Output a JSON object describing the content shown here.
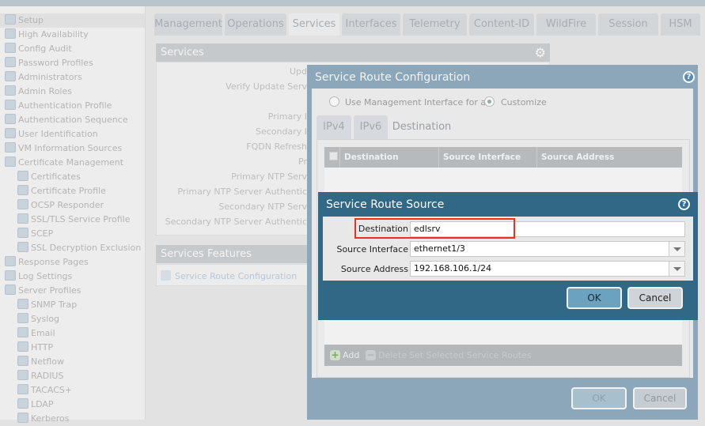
{
  "sidebar": {
    "items": [
      {
        "label": "Setup",
        "level": 0
      },
      {
        "label": "High Availability",
        "level": 0
      },
      {
        "label": "Config Audit",
        "level": 0
      },
      {
        "label": "Password Profiles",
        "level": 0
      },
      {
        "label": "Administrators",
        "level": 0
      },
      {
        "label": "Admin Roles",
        "level": 0
      },
      {
        "label": "Authentication Profile",
        "level": 0
      },
      {
        "label": "Authentication Sequence",
        "level": 0
      },
      {
        "label": "User Identification",
        "level": 0
      },
      {
        "label": "VM Information Sources",
        "level": 0
      },
      {
        "label": "Certificate Management",
        "level": 0
      },
      {
        "label": "Certificates",
        "level": 1
      },
      {
        "label": "Certificate Profile",
        "level": 1
      },
      {
        "label": "OCSP Responder",
        "level": 1
      },
      {
        "label": "SSL/TLS Service Profile",
        "level": 1
      },
      {
        "label": "SCEP",
        "level": 1
      },
      {
        "label": "SSL Decryption Exclusion",
        "level": 1
      },
      {
        "label": "Response Pages",
        "level": 0
      },
      {
        "label": "Log Settings",
        "level": 0
      },
      {
        "label": "Server Profiles",
        "level": 0
      },
      {
        "label": "SNMP Trap",
        "level": 1
      },
      {
        "label": "Syslog",
        "level": 1
      },
      {
        "label": "Email",
        "level": 1
      },
      {
        "label": "HTTP",
        "level": 1
      },
      {
        "label": "Netflow",
        "level": 1
      },
      {
        "label": "RADIUS",
        "level": 1
      },
      {
        "label": "TACACS+",
        "level": 1
      },
      {
        "label": "LDAP",
        "level": 1
      },
      {
        "label": "Kerberos",
        "level": 1
      }
    ]
  },
  "tabs": [
    "Management",
    "Operations",
    "Services",
    "Interfaces",
    "Telemetry",
    "Content-ID",
    "WildFire",
    "Session",
    "HSM"
  ],
  "services": {
    "title": "Services",
    "fields": [
      "Upd",
      "Verify Update Serv",
      "Primary I",
      "Secondary I",
      "FQDN Refresh",
      "Pr",
      "Primary NTP Serv",
      "Primary NTP Server Authentic",
      "Secondary NTP Serv",
      "Secondary NTP Server Authentic"
    ]
  },
  "features": {
    "title": "Services Features",
    "link": "Service Route Configuration"
  },
  "route_config": {
    "title": "Service Route Configuration",
    "radio_mgmt": "Use Management Interface for all",
    "radio_custom": "Customize",
    "tabs": [
      "IPv4",
      "IPv6",
      "Destination"
    ],
    "columns": [
      "Destination",
      "Source Interface",
      "Source Address"
    ],
    "add": "Add",
    "delete": "Delete",
    "set_selected": "Set Selected Service Routes",
    "ok": "OK",
    "cancel": "Cancel"
  },
  "route_source": {
    "title": "Service Route Source",
    "destination_label": "Destination",
    "destination_value": "edlsrv",
    "source_interface_label": "Source Interface",
    "source_interface_value": "ethernet1/3",
    "source_address_label": "Source Address",
    "source_address_value": "192.168.106.1/24",
    "ok": "OK",
    "cancel": "Cancel"
  }
}
